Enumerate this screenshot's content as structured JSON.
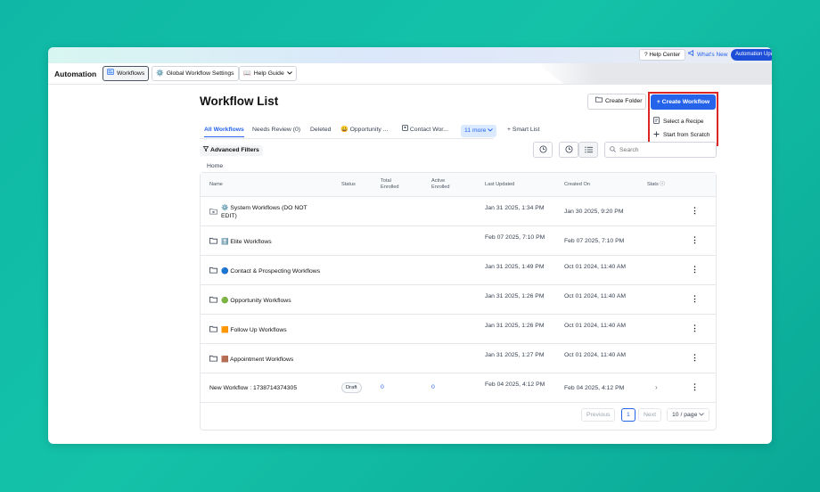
{
  "colors": {
    "accent": "#2563eb",
    "highlight": "#dc2626",
    "background": "#14c2a8"
  },
  "topbar": {
    "help_center": "? Help Center",
    "whats_new": "What's New",
    "automation_updates": "Automation Upd"
  },
  "nav": {
    "app_title": "Automation",
    "tabs": [
      {
        "label": "Workflows",
        "icon": "workflow-icon"
      },
      {
        "label": "Global Workflow Settings",
        "icon": "gear-icon"
      },
      {
        "label": "Help Guide",
        "icon": "book-icon"
      }
    ]
  },
  "page": {
    "title": "Workflow List",
    "create_folder": "Create Folder",
    "create_workflow": "+ Create Workflow",
    "dropdown": [
      "Select a Recipe",
      "Start from Scratch"
    ]
  },
  "tabs": {
    "items": [
      "All Workflows",
      "Needs Review (0)",
      "Deleted",
      "Opportunity ...",
      "Contact Wor...",
      "11 more"
    ],
    "smart_list": "+ Smart List"
  },
  "toolbar": {
    "advanced_filters": "Advanced Filters",
    "search_placeholder": "Search"
  },
  "breadcrumb": "Home",
  "table": {
    "headers": {
      "name": "Name",
      "status": "Status",
      "total_enrolled": "Total Enrolled",
      "active_enrolled": "Active Enrolled",
      "last_updated": "Last Updated",
      "created_on": "Created On",
      "stats": "Stats ⓘ"
    },
    "rows": [
      {
        "name": "⚙️ System Workflows (DO NOT EDIT)",
        "last_updated": "Jan 31 2025, 1:34 PM",
        "created_on": "Jan 30 2025, 9:20 PM"
      },
      {
        "name": "⬆️ Elite Workflows",
        "last_updated": "Feb 07 2025, 7:10 PM",
        "created_on": "Feb 07 2025, 7:10 PM"
      },
      {
        "name": "🔵 Contact & Prospecting Workflows",
        "last_updated": "Jan 31 2025, 1:49 PM",
        "created_on": "Oct 01 2024, 11:40 AM"
      },
      {
        "name": "🟢 Opportunity Workflows",
        "last_updated": "Jan 31 2025, 1:26 PM",
        "created_on": "Oct 01 2024, 11:40 AM"
      },
      {
        "name": "🟧 Follow Up Workflows",
        "last_updated": "Jan 31 2025, 1:26 PM",
        "created_on": "Oct 01 2024, 11:40 AM"
      },
      {
        "name": "🟫 Appointment Workflows",
        "last_updated": "Jan 31 2025, 1:27 PM",
        "created_on": "Oct 01 2024, 11:40 AM"
      },
      {
        "name": "New Workflow : 1738714374305",
        "status": "Draft",
        "total_enrolled": "0",
        "active_enrolled": "0",
        "last_updated": "Feb 04 2025, 4:12 PM",
        "created_on": "Feb 04 2025, 4:12 PM"
      }
    ]
  },
  "pagination": {
    "previous": "Previous",
    "page": "1",
    "next": "Next",
    "page_size": "10 / page"
  }
}
